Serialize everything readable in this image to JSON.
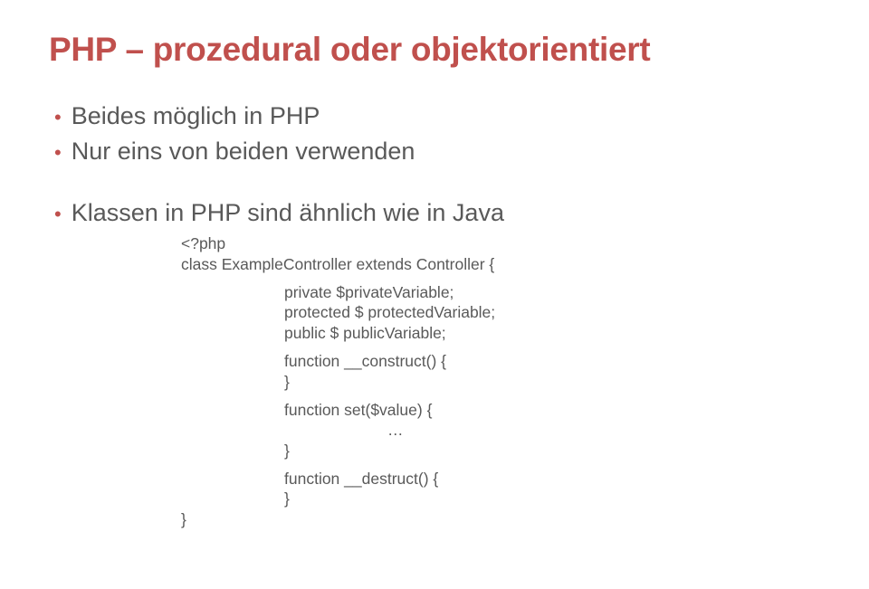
{
  "title": "PHP – prozedural oder objektorientiert",
  "bullets": {
    "b1": "Beides möglich in PHP",
    "b2": "Nur eins von beiden verwenden",
    "b3": "Klassen in PHP sind ähnlich wie in Java"
  },
  "code": {
    "l1": "<?php",
    "l2": "class ExampleController extends Controller {",
    "l3": "private $privateVariable;",
    "l4": "protected $ protectedVariable;",
    "l5": "public $ publicVariable;",
    "l6": "function __construct() {",
    "l7": "}",
    "l8": "function set($value) {",
    "l9": "…",
    "l10": "}",
    "l11": "function __destruct() {",
    "l12": "}",
    "l13": "}"
  }
}
